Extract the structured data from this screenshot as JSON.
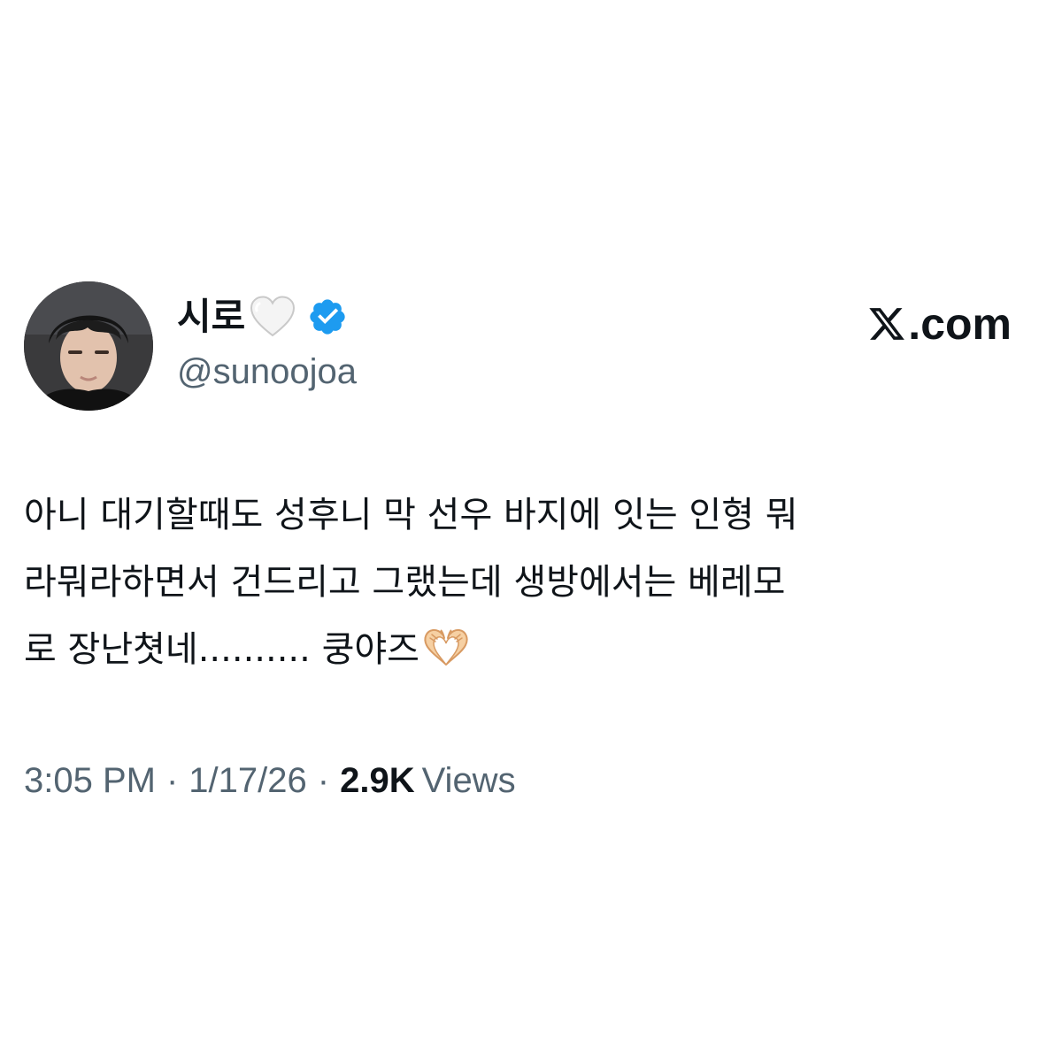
{
  "author": {
    "display_name": "시로",
    "name_emoji": "white-heart-icon",
    "verified": true,
    "verified_color": "#1d9bf0",
    "handle": "@sunoojoa"
  },
  "brand": {
    "logo": "x-logo-icon",
    "text": ".com"
  },
  "tweet": {
    "lines": [
      "아니 대기할때도 성후니 막 선우 바지에 잇는 인형 뭐",
      "라뭐라하면서 건드리고 그랬는데 생방에서는 베레모",
      "로 장난쳣네.......... 쿵야즈"
    ],
    "trailing_emoji": "heart-hands-icon"
  },
  "meta": {
    "time": "3:05 PM",
    "separator": "·",
    "date": "1/17/26",
    "views_count": "2.9K",
    "views_label": "Views"
  },
  "colors": {
    "text_primary": "#0f1419",
    "text_secondary": "#536471",
    "background": "#ffffff"
  }
}
